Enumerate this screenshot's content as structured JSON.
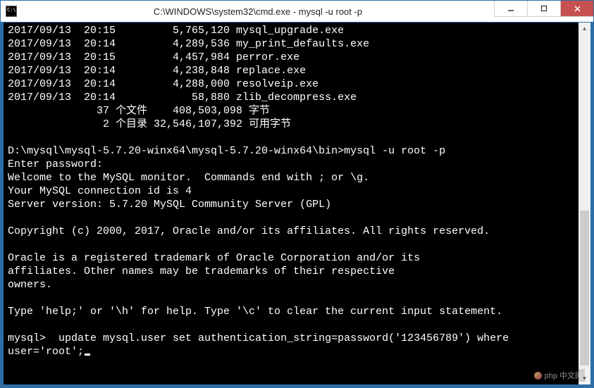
{
  "window": {
    "title": "C:\\WINDOWS\\system32\\cmd.exe - mysql  -u root -p"
  },
  "listing": {
    "rows": [
      {
        "date": "2017/09/13",
        "time": "20:15",
        "size": "5,765,120",
        "name": "mysql_upgrade.exe"
      },
      {
        "date": "2017/09/13",
        "time": "20:14",
        "size": "4,289,536",
        "name": "my_print_defaults.exe"
      },
      {
        "date": "2017/09/13",
        "time": "20:15",
        "size": "4,457,984",
        "name": "perror.exe"
      },
      {
        "date": "2017/09/13",
        "time": "20:14",
        "size": "4,238,848",
        "name": "replace.exe"
      },
      {
        "date": "2017/09/13",
        "time": "20:14",
        "size": "4,288,000",
        "name": "resolveip.exe"
      },
      {
        "date": "2017/09/13",
        "time": "20:14",
        "size": "58,880",
        "name": "zlib_decompress.exe"
      }
    ],
    "summary_files": "              37 个文件    408,503,098 字节",
    "summary_dirs": "               2 个目录 32,546,107,392 可用字节"
  },
  "session": {
    "prompt_line": "D:\\mysql\\mysql-5.7.20-winx64\\mysql-5.7.20-winx64\\bin>mysql -u root -p",
    "enter_password": "Enter password:",
    "welcome": "Welcome to the MySQL monitor.  Commands end with ; or \\g.",
    "conn_id": "Your MySQL connection id is 4",
    "server_version": "Server version: 5.7.20 MySQL Community Server (GPL)",
    "copyright": "Copyright (c) 2000, 2017, Oracle and/or its affiliates. All rights reserved.",
    "trademark1": "Oracle is a registered trademark of Oracle Corporation and/or its",
    "trademark2": "affiliates. Other names may be trademarks of their respective",
    "trademark3": "owners.",
    "help": "Type 'help;' or '\\h' for help. Type '\\c' to clear the current input statement.",
    "mysql_prompt": "mysql> ",
    "command_part1": " update mysql.user set authentication_string=password('123456789') where",
    "command_part2": "user='root';"
  },
  "watermark": {
    "text": "php 中文网"
  }
}
